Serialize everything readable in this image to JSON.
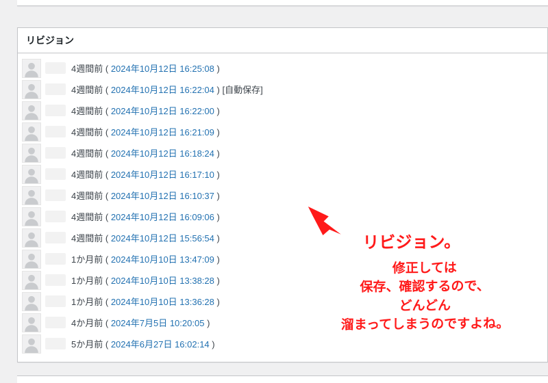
{
  "panel": {
    "title": "リビジョン"
  },
  "revisions": [
    {
      "ago": "4週間前",
      "stamp": "2024年10月12日 16:25:08",
      "suffix": ""
    },
    {
      "ago": "4週間前",
      "stamp": "2024年10月12日 16:22:04",
      "suffix": " [自動保存]"
    },
    {
      "ago": "4週間前",
      "stamp": "2024年10月12日 16:22:00",
      "suffix": ""
    },
    {
      "ago": "4週間前",
      "stamp": "2024年10月12日 16:21:09",
      "suffix": ""
    },
    {
      "ago": "4週間前",
      "stamp": "2024年10月12日 16:18:24",
      "suffix": ""
    },
    {
      "ago": "4週間前",
      "stamp": "2024年10月12日 16:17:10",
      "suffix": ""
    },
    {
      "ago": "4週間前",
      "stamp": "2024年10月12日 16:10:37",
      "suffix": ""
    },
    {
      "ago": "4週間前",
      "stamp": "2024年10月12日 16:09:06",
      "suffix": ""
    },
    {
      "ago": "4週間前",
      "stamp": "2024年10月12日 15:56:54",
      "suffix": ""
    },
    {
      "ago": "1か月前",
      "stamp": "2024年10月10日 13:47:09",
      "suffix": ""
    },
    {
      "ago": "1か月前",
      "stamp": "2024年10月10日 13:38:28",
      "suffix": ""
    },
    {
      "ago": "1か月前",
      "stamp": "2024年10月10日 13:36:28",
      "suffix": ""
    },
    {
      "ago": "4か月前",
      "stamp": "2024年7月5日 10:20:05",
      "suffix": ""
    },
    {
      "ago": "5か月前",
      "stamp": "2024年6月27日 16:02:14",
      "suffix": ""
    }
  ],
  "annotation": {
    "color": "#ff1a1a",
    "title": "リビジョン。",
    "line1": "修正しては",
    "line2": "保存、確認するので、",
    "line3": "どんどん",
    "line4": "溜まってしまうのですよね。"
  }
}
